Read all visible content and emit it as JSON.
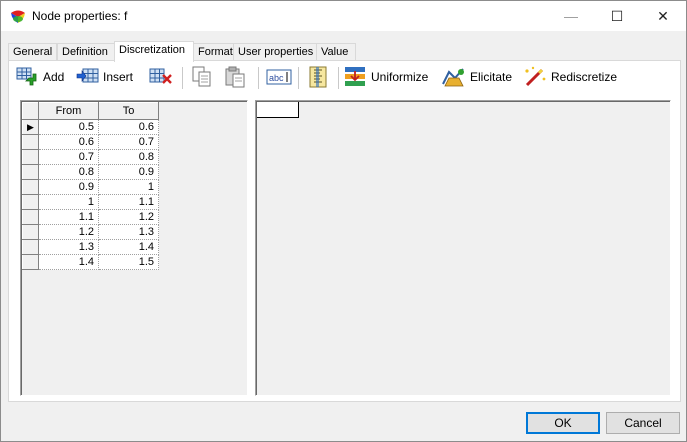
{
  "window": {
    "title": "Node properties: f",
    "controls": {
      "minimize": "—",
      "maximize": "☐",
      "close": "✕"
    }
  },
  "tabs": [
    {
      "label": "General",
      "active": false
    },
    {
      "label": "Definition",
      "active": false
    },
    {
      "label": "Discretization",
      "active": true
    },
    {
      "label": "Format",
      "active": false
    },
    {
      "label": "User properties",
      "active": false
    },
    {
      "label": "Value",
      "active": false
    }
  ],
  "toolbar": {
    "add_label": "Add",
    "insert_label": "Insert",
    "uniformize_label": "Uniformize",
    "elicitate_label": "Elicitate",
    "rediscretize_label": "Rediscretize",
    "abc_text": "abc"
  },
  "intervals": {
    "headers": [
      "From",
      "To"
    ],
    "rows": [
      [
        "0.5",
        "0.6"
      ],
      [
        "0.6",
        "0.7"
      ],
      [
        "0.7",
        "0.8"
      ],
      [
        "0.8",
        "0.9"
      ],
      [
        "0.9",
        "1"
      ],
      [
        "1",
        "1.1"
      ],
      [
        "1.1",
        "1.2"
      ],
      [
        "1.2",
        "1.3"
      ],
      [
        "1.3",
        "1.4"
      ],
      [
        "1.4",
        "1.5"
      ]
    ],
    "current_row_marker": "▶"
  },
  "buttons": {
    "ok": "OK",
    "cancel": "Cancel"
  },
  "colors": {
    "accent": "#0078d7"
  }
}
